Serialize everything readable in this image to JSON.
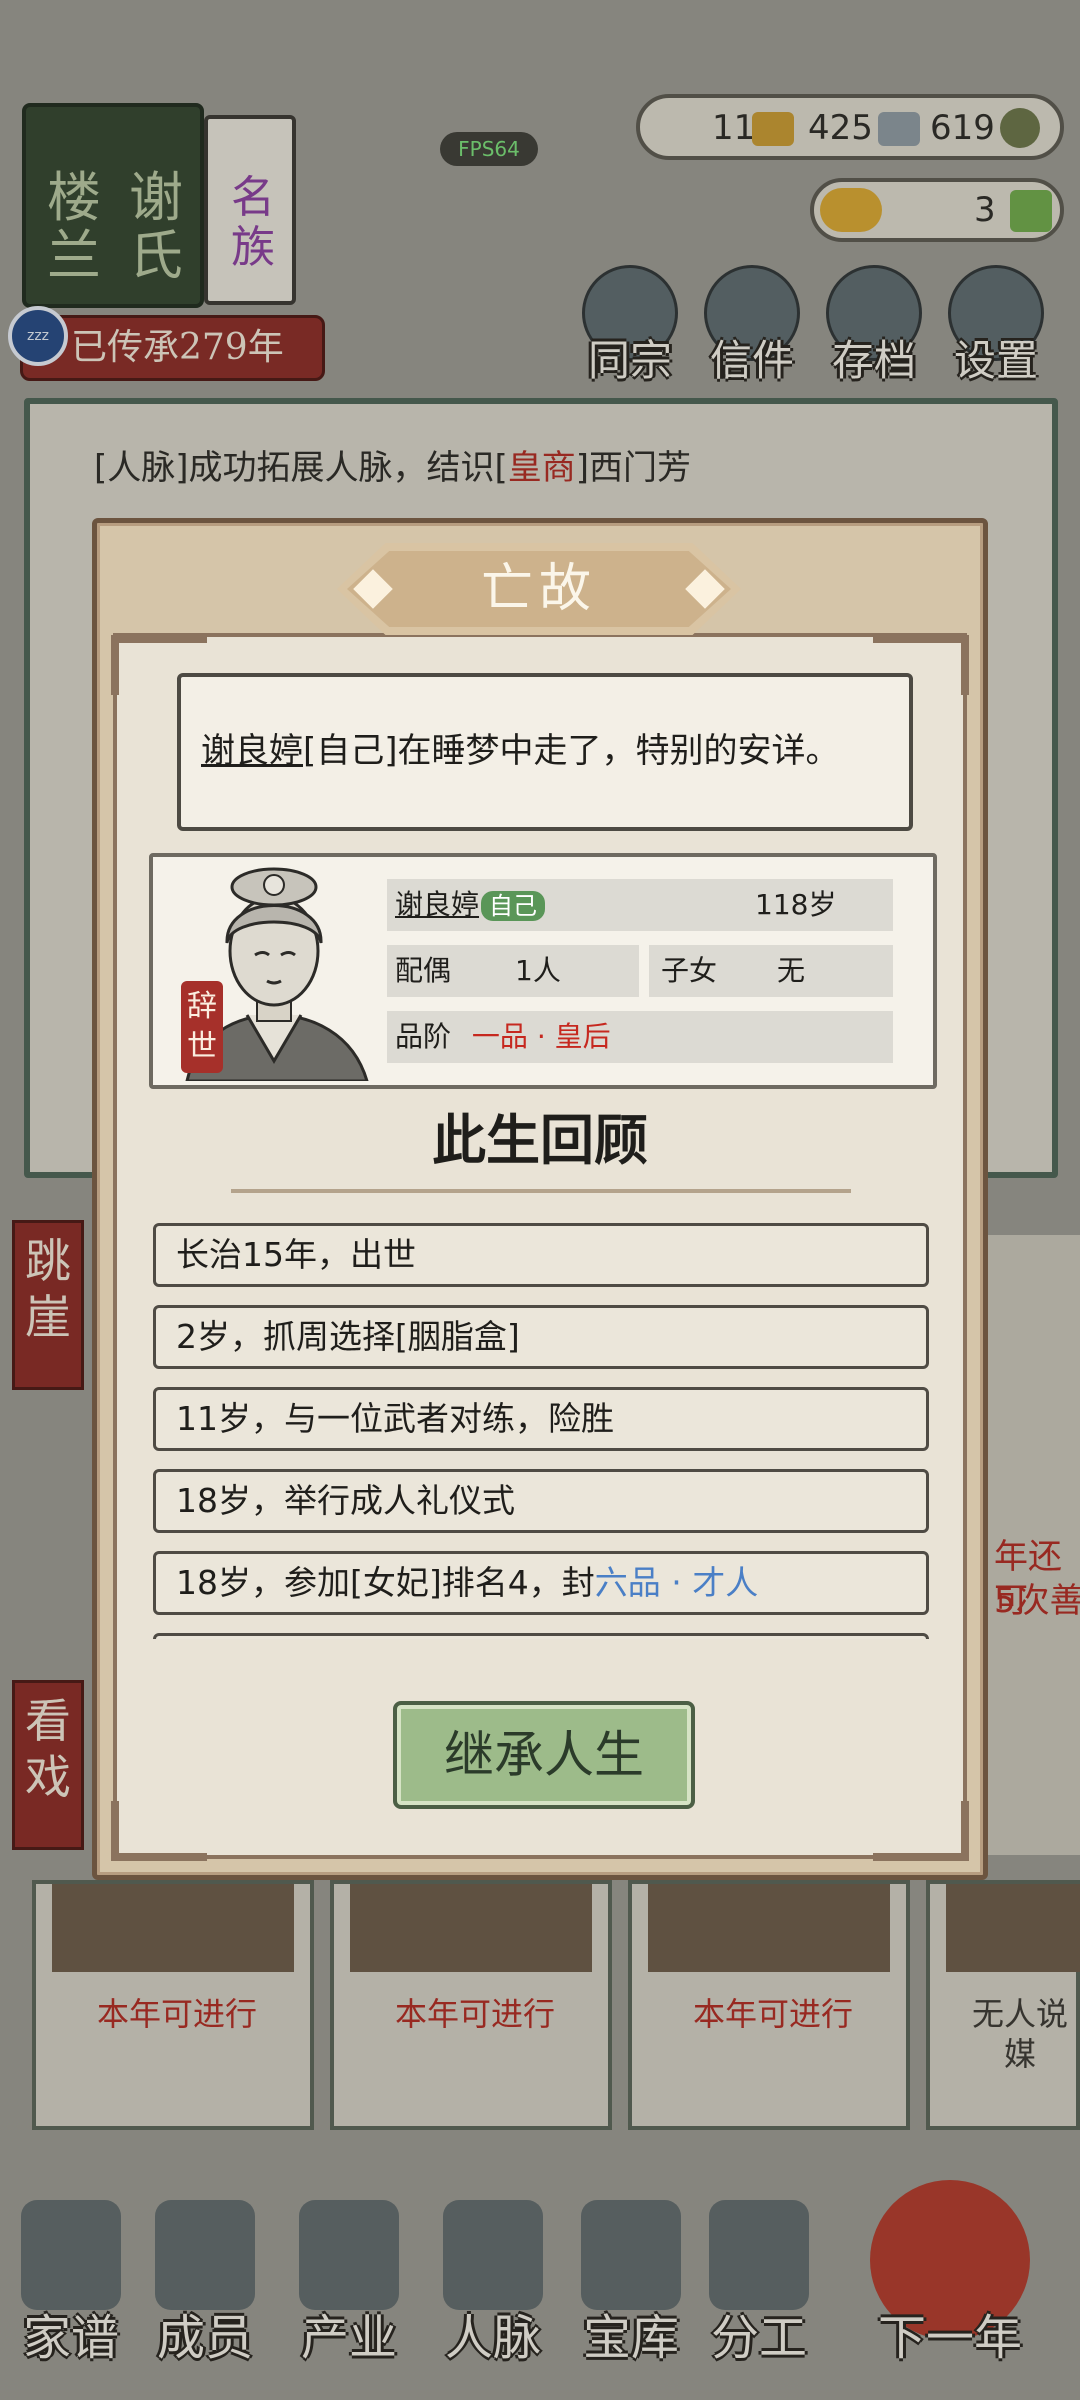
{
  "hud": {
    "fps": "FPS64",
    "family_book_title": [
      "楼兰",
      "谢氏"
    ],
    "family_tag": "名族",
    "heritage": "已传承279年",
    "resources": {
      "gold": "11",
      "silver": "425",
      "coins": "619",
      "ingots": "3"
    },
    "top_buttons": [
      "同宗",
      "信件",
      "存档",
      "设置"
    ]
  },
  "log": {
    "lines": [
      {
        "prefix": "[人脉]成功拓展人脉，结识[",
        "highlight": "皇商",
        "suffix": "]西门芳"
      }
    ]
  },
  "side": {
    "left_top": "跳崖",
    "left_bottom": "看戏",
    "right_lines": [
      "年还可",
      "5次善"
    ]
  },
  "cards": [
    {
      "status": "本年可进行"
    },
    {
      "status": "本年可进行"
    },
    {
      "status": "本年可进行"
    },
    {
      "status": "无人说媒"
    }
  ],
  "bottom_nav": [
    "家谱",
    "成员",
    "产业",
    "人脉",
    "宝库",
    "分工",
    "下一年"
  ],
  "modal": {
    "title": "亡故",
    "death_name": "谢良婷",
    "death_message": "[自己]在睡梦中走了，特别的安详。",
    "seal": "辞世",
    "person": {
      "name": "谢良婷",
      "tag": "自己",
      "age": "118岁",
      "spouse_label": "配偶",
      "spouse_value": "1人",
      "children_label": "子女",
      "children_value": "无",
      "rank_label": "品阶",
      "rank_value": "一品 · 皇后",
      "rank_color": "#c6281f"
    },
    "review_title": "此生回顾",
    "events": [
      {
        "text": "长治15年，出世",
        "highlight": ""
      },
      {
        "text": "2岁，抓周选择[胭脂盒]",
        "highlight": ""
      },
      {
        "text": "11岁，与一位武者对练，险胜",
        "highlight": ""
      },
      {
        "text": "18岁，举行成人礼仪式",
        "highlight": ""
      },
      {
        "text": "18岁，参加[女妃]排名4，封",
        "highlight": "六品 · 才人"
      }
    ],
    "highlight_color": "#4a7fc6",
    "inherit_button": "继承人生"
  }
}
